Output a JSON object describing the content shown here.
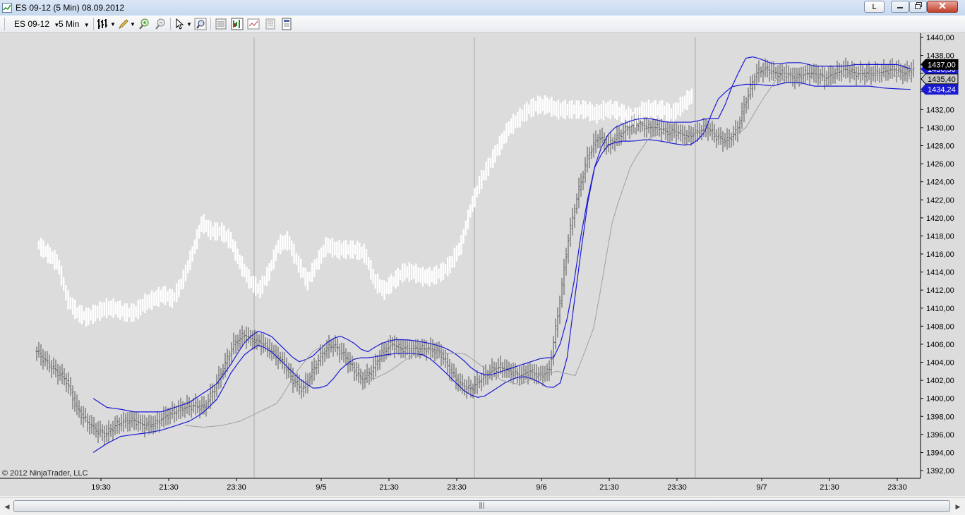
{
  "window": {
    "title": "ES 09-12 (5 Min)  08.09.2012",
    "link_button": "L",
    "minimize_icon": "minimize-icon",
    "maximize_icon": "restore-icon",
    "close_icon": "close-icon"
  },
  "toolbar": {
    "instrument": "ES 09-12",
    "interval": "5 Min",
    "icons": [
      "bar-type-icon",
      "drawing-tool-icon",
      "zoom-in-icon",
      "zoom-out-icon",
      "cursor-icon",
      "search-icon",
      "properties-icon",
      "indicators-icon",
      "strategies-icon",
      "data-box-icon",
      "chart-trader-icon"
    ]
  },
  "copyright": "© 2012 NinjaTrader, LLC",
  "price_tags": {
    "last": "1437,00",
    "mid": "1435,40",
    "lower": "1434,24",
    "hidden_upper": "1436,50"
  },
  "colors": {
    "background": "#dcdcdc",
    "bands": "#1a1ad2",
    "bars": "#555555",
    "tick_bars": "#ffffff",
    "tag_last_bg": "#000000",
    "tag_band_bg": "#1a1ad2"
  },
  "chart_data": {
    "type": "line",
    "title": "",
    "xlabel": "",
    "ylabel": "",
    "ylim": [
      1391,
      1441
    ],
    "y_ticks": [
      "1440,00",
      "1438,00",
      "1436,00",
      "1434,00",
      "1432,00",
      "1430,00",
      "1428,00",
      "1426,00",
      "1424,00",
      "1422,00",
      "1420,00",
      "1418,00",
      "1416,00",
      "1414,00",
      "1412,00",
      "1410,00",
      "1408,00",
      "1406,00",
      "1404,00",
      "1402,00",
      "1400,00",
      "1398,00",
      "1396,00",
      "1394,00",
      "1392,00"
    ],
    "x_ticks": [
      "19:30",
      "21:30",
      "23:30",
      "9/5",
      "21:30",
      "23:30",
      "9/6",
      "21:30",
      "23:30",
      "9/7",
      "21:30",
      "23:30"
    ],
    "grid": false,
    "series": [
      {
        "values": [
          1405.2,
          1404,
          1403,
          1402,
          1399,
          1397.5,
          1396.5,
          1396,
          1397,
          1397.5,
          1397.5,
          1397,
          1397.2,
          1398,
          1398.5,
          1399,
          1399.2,
          1399,
          1401,
          1403.5,
          1406,
          1407,
          1406.5,
          1406,
          1405,
          1404,
          1402,
          1401,
          1403,
          1405,
          1406,
          1405,
          1403.5,
          1402,
          1403,
          1405,
          1406,
          1405.5,
          1405.5,
          1405.5,
          1405.5,
          1405,
          1403,
          1401.5,
          1401,
          1402,
          1403,
          1403.5,
          1403,
          1402.5,
          1403,
          1402.5,
          1403,
          1410,
          1418,
          1423,
          1427,
          1429,
          1428,
          1429,
          1430,
          1430.5,
          1430,
          1430,
          1429.5,
          1429.5,
          1429,
          1429.5,
          1430,
          1429,
          1428.5,
          1429.5,
          1433,
          1436,
          1436.5,
          1436,
          1436,
          1435.5,
          1436,
          1436,
          1435.5,
          1436,
          1436.5,
          1436,
          1436,
          1436,
          1436.2,
          1436.5,
          1436,
          1436.5
        ]
      },
      {
        "values": [
          1417,
          1416,
          1415,
          1411,
          1409.5,
          1409,
          1409.5,
          1410,
          1410,
          1409.5,
          1409.5,
          1410.5,
          1411,
          1411.5,
          1411,
          1413,
          1416,
          1419.5,
          1418.5,
          1418.5,
          1417.5,
          1415,
          1413,
          1412,
          1414,
          1417,
          1417.5,
          1415,
          1413,
          1415,
          1417,
          1416.5,
          1416.5,
          1416.5,
          1416,
          1413,
          1412,
          1413,
          1414,
          1414,
          1413.5,
          1413.5,
          1414,
          1415,
          1417,
          1421,
          1424,
          1426,
          1428,
          1430,
          1431,
          1432,
          1432.5,
          1432.5,
          1432,
          1432,
          1432,
          1432,
          1431.5,
          1432,
          1432,
          1431.5,
          1431,
          1432,
          1432,
          1432,
          1431.5,
          1432.5,
          1433.5
        ]
      },
      {
        "values": [
          1400,
          1399,
          1398.8,
          1398.5,
          1398.5,
          1398.5,
          1399,
          1399.5,
          1400.5,
          1401.5,
          1403.5,
          1406,
          1407.5,
          1407,
          1405.5,
          1404,
          1404.5,
          1406,
          1407,
          1406.3,
          1405,
          1406,
          1406.5,
          1406.5,
          1406.3,
          1406,
          1405.5,
          1404.5,
          1403,
          1402.5,
          1403,
          1403.5,
          1404,
          1404.5,
          1404.5,
          1410,
          1420,
          1427,
          1429.8,
          1430.5,
          1431,
          1431,
          1430.6,
          1430.6,
          1430.6,
          1431,
          1431,
          1435,
          1438,
          1437.6,
          1437,
          1437.2,
          1437.2,
          1436.8,
          1436.8,
          1436.8,
          1437,
          1437,
          1437,
          1437,
          1436.5
        ]
      },
      {
        "values": [
          1394,
          1395,
          1395.8,
          1396,
          1396.2,
          1396.5,
          1397,
          1397.5,
          1398.5,
          1400,
          1403,
          1405,
          1406,
          1405,
          1403.5,
          1402,
          1401,
          1401.5,
          1403.5,
          1404.5,
          1404.5,
          1404.8,
          1405,
          1405,
          1404.8,
          1403.5,
          1402,
          1400.5,
          1400,
          1401,
          1402,
          1402.5,
          1402,
          1401,
          1402,
          1414,
          1425,
          1428,
          1428.5,
          1428.5,
          1428.7,
          1428.5,
          1428.2,
          1428,
          1429,
          1433,
          1434.5,
          1434.8,
          1434.8,
          1434.6,
          1435,
          1435,
          1434.6,
          1434.6,
          1434.6,
          1434.6,
          1434.6,
          1434.4,
          1434.3,
          1434.24
        ]
      },
      {
        "values": [
          1397,
          1396.8,
          1397,
          1397.5,
          1398.5,
          1399.5,
          1403,
          1405.5,
          1406,
          1404,
          1402,
          1403,
          1404.5,
          1405.5,
          1405,
          1405,
          1403.5,
          1402,
          1401.5,
          1402.5,
          1403,
          1402.5,
          1408,
          1420,
          1426,
          1429,
          1429.5,
          1429.5,
          1429.5,
          1429.3,
          1429.5,
          1433,
          1436,
          1436,
          1435.8,
          1435.8,
          1435.8,
          1435.8,
          1435.8,
          1435.4
        ]
      }
    ]
  }
}
